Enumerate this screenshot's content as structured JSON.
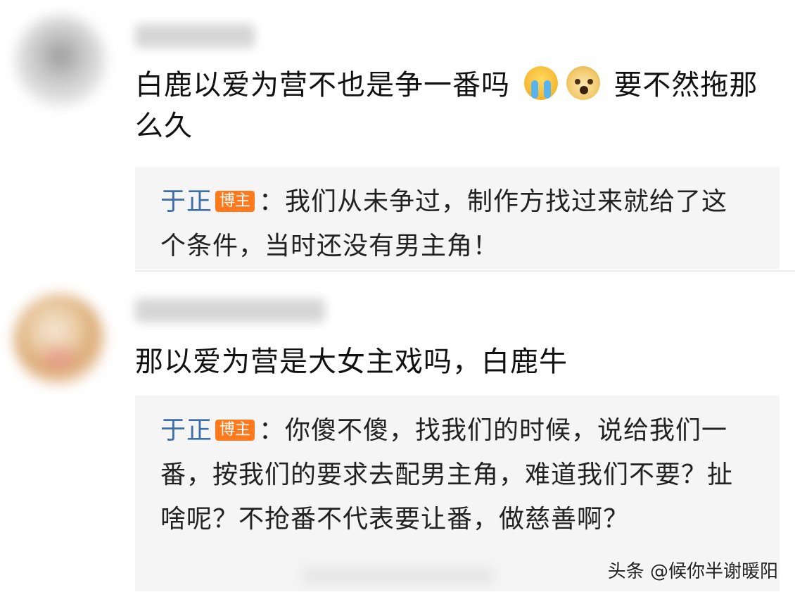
{
  "comments": [
    {
      "text_before": "白鹿以爱为营不也是争一番吗",
      "emojis": [
        "crying-face-icon",
        "doge-icon"
      ],
      "text_after": "要不然拖那么久",
      "reply": {
        "name": "于正",
        "badge": "博主",
        "text": "：我们从未争过，制作方找过来就给了这个条件，当时还没有男主角！"
      }
    },
    {
      "text": "那以爱为营是大女主戏吗，白鹿牛",
      "reply": {
        "name": "于正",
        "badge": "博主",
        "text": "：你傻不傻，找我们的时候，说给我们一番，按我们的要求去配男主角，难道我们不要？扯啥呢？不抢番不代表要让番，做慈善啊？"
      }
    }
  ],
  "watermark": "头条 @候你半谢暖阳",
  "colors": {
    "reply_name": "#3d6ea8",
    "badge_bg": "#ff7a1c",
    "reply_bg": "#f5f5f5"
  }
}
